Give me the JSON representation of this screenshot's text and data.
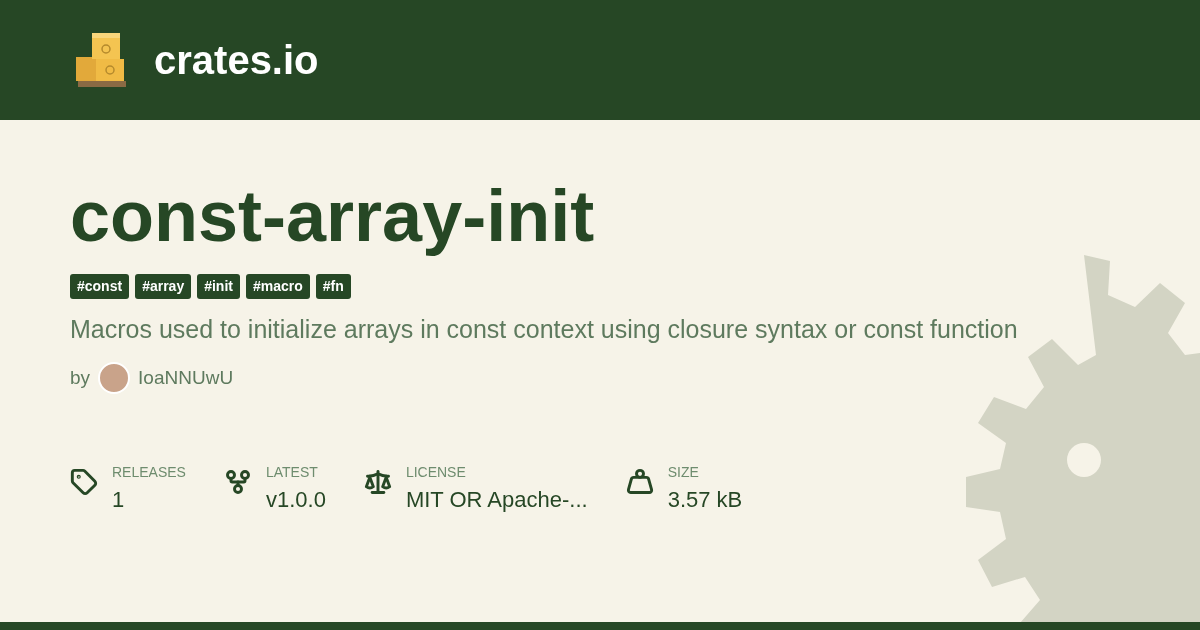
{
  "header": {
    "site_name": "crates.io"
  },
  "crate": {
    "name": "const-array-init",
    "keywords": [
      "#const",
      "#array",
      "#init",
      "#macro",
      "#fn"
    ],
    "description": "Macros used to initialize arrays in const context using closure syntax or const function",
    "author": {
      "prefix": "by",
      "name": "IoaNNUwU"
    }
  },
  "stats": [
    {
      "kind": "releases",
      "label": "RELEASES",
      "value": "1"
    },
    {
      "kind": "latest",
      "label": "LATEST",
      "value": "v1.0.0"
    },
    {
      "kind": "license",
      "label": "LICENSE",
      "value": "MIT OR Apache-..."
    },
    {
      "kind": "size",
      "label": "SIZE",
      "value": "3.57 kB"
    }
  ]
}
